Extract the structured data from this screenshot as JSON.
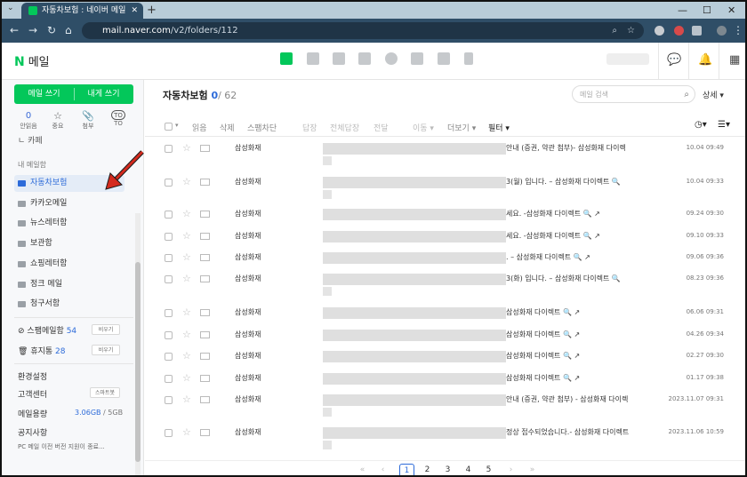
{
  "browser": {
    "tab_title": "자동차보험 : 네이버 메일",
    "url_host": "mail.naver.com",
    "url_path": "/v2/folders/112"
  },
  "header": {
    "logo": "N",
    "logo_text": "메일"
  },
  "sidebar": {
    "compose_mail": "메일 쓰기",
    "compose_self": "내게 쓰기",
    "quick": [
      {
        "label": "안읽음",
        "value": "0"
      },
      {
        "label": "중요",
        "icon": "star-icon"
      },
      {
        "label": "첨부",
        "icon": "clip-icon"
      },
      {
        "label": "TO",
        "icon": "to-icon"
      }
    ],
    "cut_item": "카페",
    "my_mailbox": "내 메일함",
    "folders": [
      "자동차보험",
      "카카오메일",
      "뉴스레터함",
      "보관함",
      "쇼핑레터함",
      "정크 메일",
      "청구서함"
    ],
    "spam_label": "스팸메일함",
    "spam_count": "54",
    "trash_label": "휴지통",
    "trash_count": "28",
    "empty_btn": "비우기",
    "settings": "환경설정",
    "support": "고객센터",
    "smartbot": "스마트봇",
    "capacity_label": "메일용량",
    "capacity_used": "3.06GB",
    "capacity_total": "/ 5GB",
    "notice": "공지사항",
    "notice_text": "PC 메일 이전 버전 지원이 종료..."
  },
  "main": {
    "folder_title": "자동차보험",
    "unread": "0",
    "total": "/ 62",
    "search_placeholder": "메일 검색",
    "detail": "상세 ▾",
    "toolbar": {
      "read": "읽음",
      "delete": "삭제",
      "spam": "스팸차단",
      "reply": "답장",
      "reply_all": "전체답장",
      "forward": "전달",
      "move": "이동 ▾",
      "more": "더보기 ▾",
      "filter": "필터 ▾"
    },
    "rows": [
      {
        "sender": "삼성화재",
        "subject": "안내 (증권, 약관 첨부)- 삼성화재 다이렉",
        "date": "10.04 09:49"
      },
      {
        "sender": "삼성화재",
        "subject": "3(월) 입니다. – 삼성화재 다이렉트 🔍",
        "date": "10.04 09:33"
      },
      {
        "sender": "삼성화재",
        "subject": "세요. -삼성화재 다이렉트 🔍 ↗",
        "date": "09.24 09:30"
      },
      {
        "sender": "삼성화재",
        "subject": "세요. -삼성화재 다이렉트 🔍 ↗",
        "date": "09.10 09:33"
      },
      {
        "sender": "삼성화재",
        "subject": ". – 삼성화재 다이렉트 🔍 ↗",
        "date": "09.06 09:36"
      },
      {
        "sender": "삼성화재",
        "subject": "3(화) 입니다. – 삼성화재 다이렉트 🔍",
        "date": "08.23 09:36"
      },
      {
        "sender": "삼성화재",
        "subject": "삼성화재 다이렉트 🔍 ↗",
        "date": "06.06 09:31"
      },
      {
        "sender": "삼성화재",
        "subject": "삼성화재 다이렉트 🔍 ↗",
        "date": "04.26 09:34"
      },
      {
        "sender": "삼성화재",
        "subject": "삼성화재 다이렉트 🔍 ↗",
        "date": "02.27 09:30"
      },
      {
        "sender": "삼성화재",
        "subject": "삼성화재 다이렉트 🔍 ↗",
        "date": "01.17 09:38"
      },
      {
        "sender": "삼성화재",
        "subject": "안내 (증권, 약관 첨부) - 삼성화재 다이렉",
        "date": "2023.11.07 09:31"
      },
      {
        "sender": "삼성화재",
        "subject": "정상 접수되었습니다.- 삼성화재 다이렉트",
        "date": "2023.11.06 10:59"
      }
    ],
    "pages": [
      "1",
      "2",
      "3",
      "4",
      "5"
    ]
  },
  "colors": {
    "brand": "#03c75a",
    "accent": "#2d6bd9"
  }
}
